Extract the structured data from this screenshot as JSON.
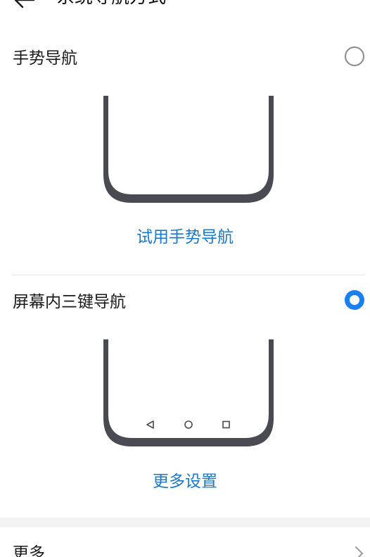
{
  "header": {
    "title": "系统导航方式"
  },
  "options": [
    {
      "label": "手势导航",
      "selected": false,
      "action": "试用手势导航"
    },
    {
      "label": "屏幕内三键导航",
      "selected": true,
      "action": "更多设置"
    }
  ],
  "more": {
    "label": "更多"
  },
  "colors": {
    "accent": "#1a7ff0",
    "link": "#1b78c8",
    "phone_frame": "#4a4b52"
  },
  "icons": {
    "back": "arrow-left-icon",
    "nav_back": "triangle-back-icon",
    "nav_home": "circle-home-icon",
    "nav_recent": "square-recent-icon",
    "chevron": "chevron-right-icon"
  }
}
